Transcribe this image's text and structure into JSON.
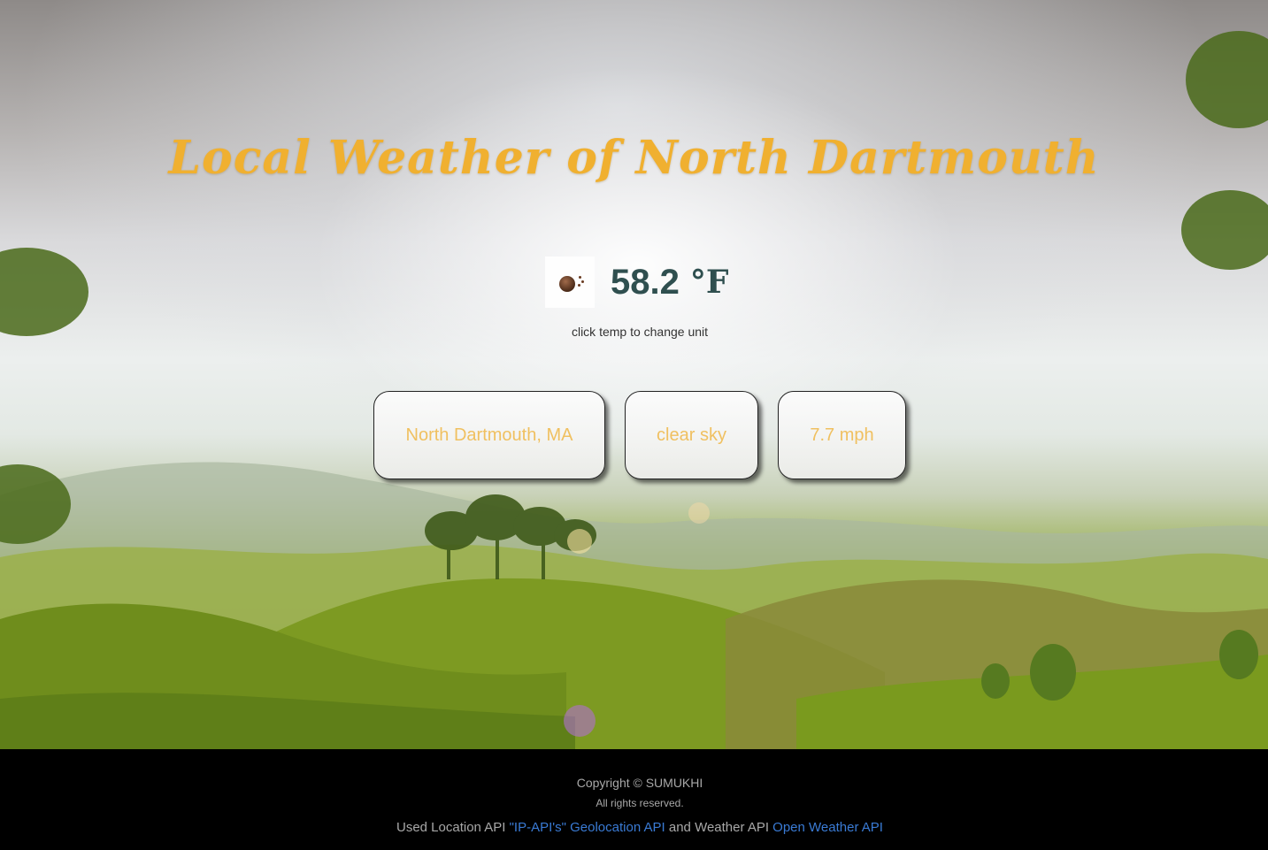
{
  "header": {
    "title": "Local Weather of North Dartmouth"
  },
  "current": {
    "icon": "clear-sky-night-icon",
    "temperature": "58.2",
    "unit": "°F",
    "hint": "click temp to change unit"
  },
  "cards": {
    "location": "North Dartmouth, MA",
    "description": "clear sky",
    "wind": "7.7 mph"
  },
  "footer": {
    "copyright": "Copyright © SUMUKHI",
    "rights": "All rights reserved.",
    "credits_prefix": "Used Location API ",
    "location_api_link": "\"IP-API's\" Geolocation API",
    "credits_middle": " and Weather API ",
    "weather_api_link": "Open Weather API"
  },
  "colors": {
    "title": "#f0b030",
    "temperature": "#2f4f4f",
    "card_text": "#f0c060",
    "footer_bg": "#000000",
    "link": "#3a7bd5"
  }
}
